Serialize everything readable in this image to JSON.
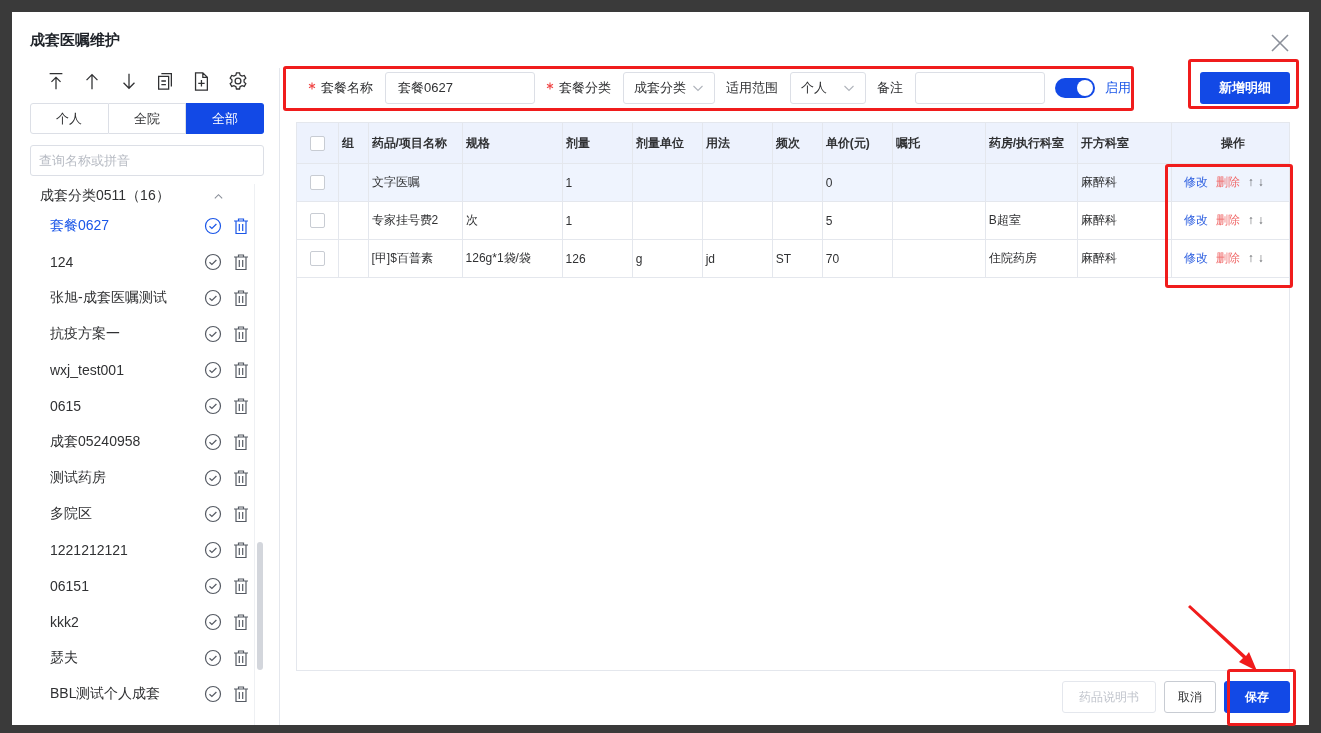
{
  "dialog": {
    "title": "成套医嘱维护"
  },
  "sidebar": {
    "scope_tabs": [
      {
        "label": "个人",
        "selected": false
      },
      {
        "label": "全院",
        "selected": false
      },
      {
        "label": "全部",
        "selected": true
      }
    ],
    "search": {
      "placeholder": "查询名称或拼音"
    },
    "groups": [
      {
        "label": "成套分类0511（16）",
        "expanded": true,
        "children": [
          {
            "label": "套餐0627",
            "selected": true
          },
          {
            "label": "124",
            "selected": false
          },
          {
            "label": "张旭-成套医嘱测试",
            "selected": false
          },
          {
            "label": "抗疫方案一",
            "selected": false
          },
          {
            "label": "wxj_test001",
            "selected": false
          },
          {
            "label": "0615",
            "selected": false
          },
          {
            "label": "成套05240958",
            "selected": false
          },
          {
            "label": "测试药房",
            "selected": false
          },
          {
            "label": "多院区",
            "selected": false
          },
          {
            "label": "1221212121",
            "selected": false
          },
          {
            "label": "06151",
            "selected": false
          },
          {
            "label": "kkk2",
            "selected": false
          },
          {
            "label": "瑟夫",
            "selected": false
          },
          {
            "label": "BBL测试个人成套",
            "selected": false
          }
        ]
      }
    ]
  },
  "form": {
    "fields": [
      {
        "kind": "text",
        "label": "套餐名称",
        "required": true,
        "value": "套餐0627"
      },
      {
        "kind": "select",
        "label": "套餐分类",
        "required": true,
        "value": "成套分类"
      },
      {
        "kind": "select",
        "label": "适用范围",
        "required": false,
        "value": "个人"
      },
      {
        "kind": "text",
        "label": "备注",
        "required": false
      }
    ],
    "toggle": {
      "label": "启用",
      "on": true
    },
    "add_button": "新增明细"
  },
  "table": {
    "all_checked": false,
    "columns": [
      "组",
      "药品/项目名称",
      "规格",
      "剂量",
      "剂量单位",
      "用法",
      "频次",
      "单价(元)",
      "嘱托",
      "药房/执行科室",
      "开方科室",
      "操作"
    ],
    "rows": [
      {
        "checked": false,
        "selected": true,
        "cells": [
          null,
          "文字医嘱",
          null,
          "1",
          null,
          null,
          null,
          "0",
          null,
          null,
          "麻醉科"
        ],
        "actions": [
          {
            "kind": "edit",
            "label": "修改"
          },
          {
            "kind": "delete",
            "label": "删除"
          },
          {
            "kind": "move",
            "label": "↑"
          },
          {
            "kind": "move",
            "label": "↓"
          }
        ]
      },
      {
        "checked": false,
        "selected": false,
        "cells": [
          null,
          "专家挂号费2",
          "次",
          "1",
          null,
          null,
          null,
          "5",
          null,
          "B超室",
          "麻醉科"
        ],
        "actions": [
          {
            "kind": "edit",
            "label": "修改"
          },
          {
            "kind": "delete",
            "label": "删除"
          },
          {
            "kind": "move",
            "label": "↑"
          },
          {
            "kind": "move",
            "label": "↓"
          }
        ]
      },
      {
        "checked": false,
        "selected": false,
        "cells": [
          null,
          "[甲]$百普素",
          "126g*1袋/袋",
          "126",
          "g",
          "jd",
          "ST",
          "70",
          null,
          "住院药房",
          "麻醉科"
        ],
        "actions": [
          {
            "kind": "edit",
            "label": "修改"
          },
          {
            "kind": "delete",
            "label": "删除"
          },
          {
            "kind": "move",
            "label": "↑"
          },
          {
            "kind": "move",
            "label": "↓"
          }
        ]
      }
    ]
  },
  "footer": {
    "buttons": [
      {
        "kind": "default",
        "label": "药品说明书",
        "disabled": true
      },
      {
        "kind": "default",
        "label": "取消",
        "disabled": false
      },
      {
        "kind": "primary",
        "label": "保存",
        "disabled": false
      }
    ]
  }
}
